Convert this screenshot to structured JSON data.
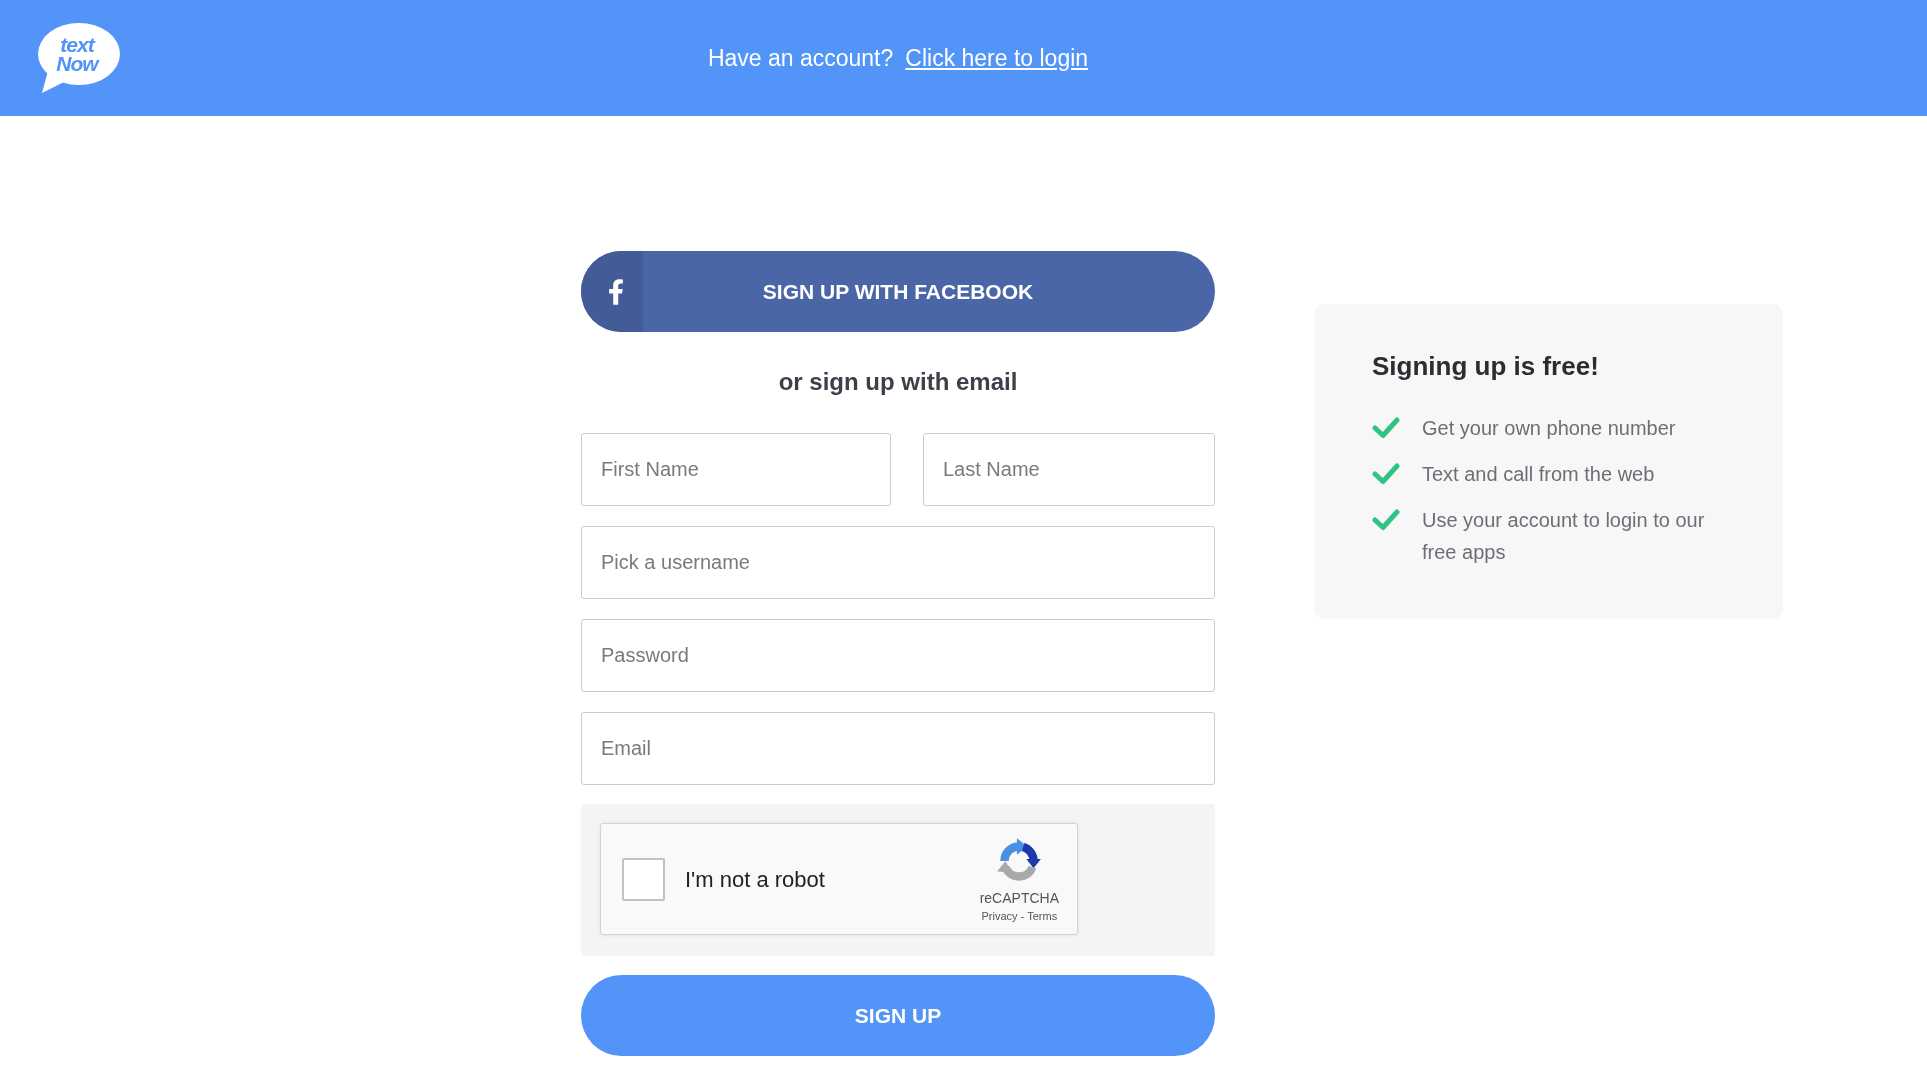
{
  "header": {
    "logo": {
      "lines": [
        "text",
        "Now"
      ]
    },
    "prompt": "Have an account?",
    "login_link": "Click here to login"
  },
  "signup_form": {
    "facebook_button": "SIGN UP WITH FACEBOOK",
    "divider_text": "or sign up with email",
    "name_row": [
      {
        "placeholder": "First Name"
      },
      {
        "placeholder": "Last Name"
      }
    ],
    "fields": [
      {
        "placeholder": "Pick a username"
      },
      {
        "placeholder": "Password"
      },
      {
        "placeholder": "Email"
      }
    ],
    "captcha": {
      "label": "I'm not a robot",
      "checked": false,
      "brand": "reCAPTCHA",
      "links": [
        "Privacy",
        "Terms"
      ],
      "separator": "-"
    },
    "submit_button": "SIGN UP"
  },
  "benefits_panel": {
    "title": "Signing up is free!",
    "items": [
      "Get your own phone number",
      "Text and call from the web",
      "Use your account to login to our free apps"
    ]
  }
}
